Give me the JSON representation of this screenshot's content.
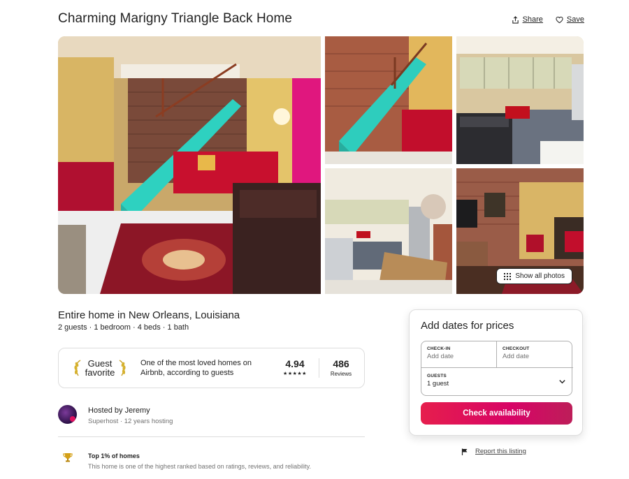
{
  "listing": {
    "title": "Charming Marigny Triangle Back Home",
    "share_label": "Share",
    "save_label": "Save",
    "show_all_label": "Show all photos",
    "subtitle": "Entire home in New Orleans, Louisiana",
    "details": "2 guests · 1 bedroom · 4 beds · 1 bath"
  },
  "guest_favorite": {
    "label_line1": "Guest",
    "label_line2": "favorite",
    "description": "One of the most loved homes on Airbnb, according to guests",
    "rating": "4.94",
    "stars": "★★★★★",
    "reviews_count": "486",
    "reviews_label": "Reviews"
  },
  "host": {
    "name": "Hosted by Jeremy",
    "subtitle": "Superhost · 12 years hosting"
  },
  "highlight": {
    "title": "Top 1% of homes",
    "description": "This home is one of the highest ranked based on ratings, reviews, and reliability."
  },
  "booking": {
    "title": "Add dates for prices",
    "checkin_label": "CHECK-IN",
    "checkin_value": "Add date",
    "checkout_label": "CHECKOUT",
    "checkout_value": "Add date",
    "guests_label": "GUESTS",
    "guests_value": "1 guest",
    "button_label": "Check availability"
  },
  "report_label": "Report this listing",
  "colors": {
    "brand": "#e61e4d",
    "text": "#222222",
    "muted": "#717171",
    "border": "#dddddd"
  }
}
